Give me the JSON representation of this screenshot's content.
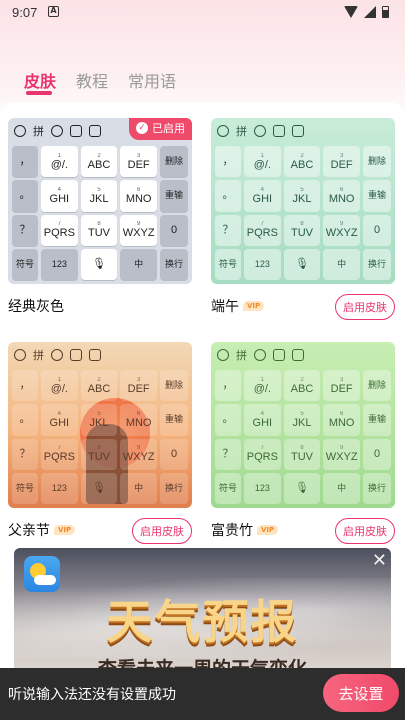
{
  "status": {
    "time": "9:07",
    "notif_icon": "A"
  },
  "tabs": [
    {
      "label": "皮肤"
    },
    {
      "label": "教程"
    },
    {
      "label": "常用语"
    }
  ],
  "keyboard": {
    "pinyin": "拼",
    "row1": [
      "@/.",
      "ABC",
      "DEF",
      "删除"
    ],
    "row2": [
      "GHI",
      "JKL",
      "MNO",
      "重输"
    ],
    "row3": [
      "PQRS",
      "TUV",
      "WXYZ",
      "0"
    ],
    "row4": [
      "符号",
      "123",
      "中",
      "换行"
    ],
    "side": [
      "，",
      "。",
      "？",
      "！"
    ],
    "nums": [
      "1",
      "2",
      "3",
      "4",
      "5",
      "6",
      "7",
      "8",
      "9"
    ]
  },
  "skins": [
    {
      "name": "经典灰色",
      "badge": "已启用",
      "vip": false
    },
    {
      "name": "端午",
      "vip": true,
      "vip_label": "VIP",
      "button": "启用皮肤"
    },
    {
      "name": "父亲节",
      "vip": true,
      "vip_label": "VIP",
      "button": "启用皮肤"
    },
    {
      "name": "富贵竹",
      "vip": true,
      "vip_label": "VIP",
      "button": "启用皮肤"
    }
  ],
  "ad": {
    "title": "天气预报",
    "subtitle": "查看未来一周的天气变化",
    "close": "✕"
  },
  "toast": {
    "message": "听说输入法还没有设置成功",
    "button": "去设置"
  }
}
